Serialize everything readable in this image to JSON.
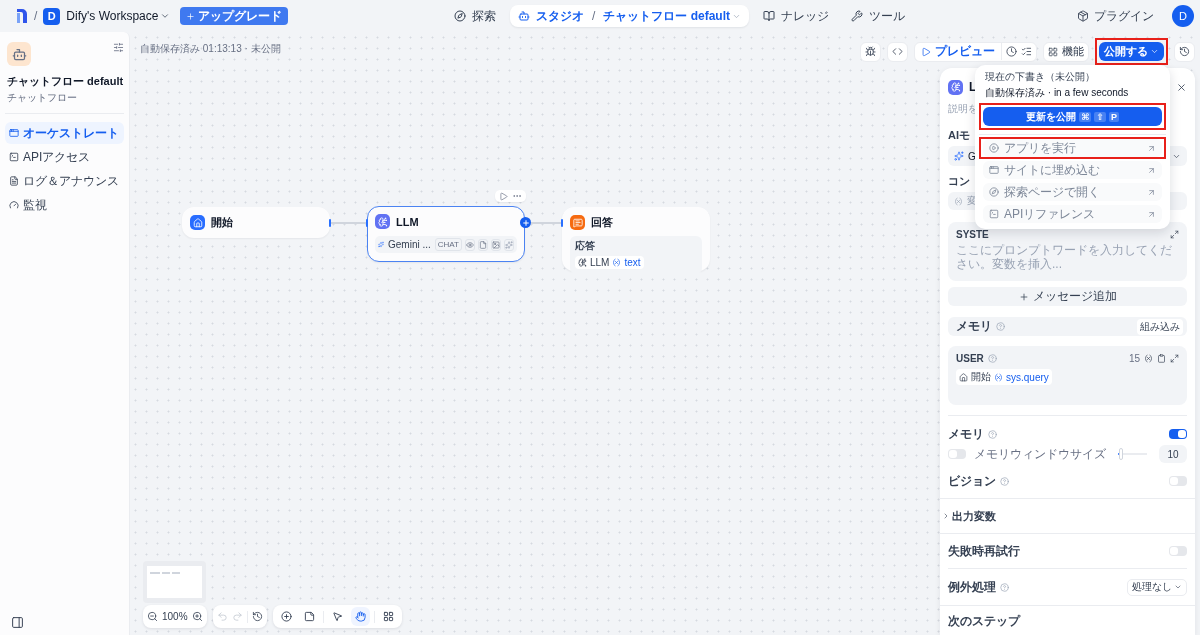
{
  "topbar": {
    "separator": "/",
    "workspace_initial": "D",
    "workspace": "Dify's Workspace",
    "upgrade": "アップグレード",
    "nav": [
      {
        "label": "探索",
        "selected": false
      },
      {
        "label": "スタジオ",
        "selected": true,
        "separator": "/",
        "app": "チャットフロー default"
      },
      {
        "label": "ナレッジ",
        "selected": false
      },
      {
        "label": "ツール",
        "selected": false
      }
    ],
    "plugins": "プラグイン",
    "avatar": "D"
  },
  "sidebar": {
    "app_title": "チャットフロー default",
    "app_type": "チャットフロー",
    "items": [
      {
        "label": "オーケストレート",
        "selected": true
      },
      {
        "label": "APIアクセス",
        "selected": false
      },
      {
        "label": "ログ＆アナウンス",
        "selected": false
      },
      {
        "label": "監視",
        "selected": false
      }
    ]
  },
  "canvas": {
    "status": "自動保存済み 01:13:13 · 未公開",
    "preview": "プレビュー",
    "features": "機能",
    "publish": {
      "label": "公開する",
      "highlighted": true
    },
    "nodes": [
      {
        "kind": "start",
        "title": "開始",
        "selected": false
      },
      {
        "kind": "llm",
        "title": "LLM",
        "selected": true,
        "model": "Gemini ...",
        "mode": "CHAT"
      },
      {
        "kind": "answer",
        "title": "回答",
        "selected": false,
        "field": "応答",
        "source": "LLM",
        "variable": "text"
      }
    ],
    "zoom": "100%",
    "tools": [
      {
        "kind": "add",
        "selected": false
      },
      {
        "kind": "note",
        "selected": false
      },
      {
        "kind": "pointer",
        "selected": false
      },
      {
        "kind": "hand",
        "selected": true
      },
      {
        "kind": "layout",
        "selected": false
      }
    ]
  },
  "publish_menu": {
    "title": "現在の下書き（未公開）",
    "status": "自動保存済み · in a few seconds",
    "button": {
      "label": "更新を公開",
      "keys": [
        "⌘",
        "⇧",
        "P"
      ],
      "highlighted": true
    },
    "items": [
      {
        "label": "アプリを実行",
        "disabled": true,
        "highlighted": true
      },
      {
        "label": "サイトに埋め込む",
        "disabled": true,
        "highlighted": false
      },
      {
        "label": "探索ページで開く",
        "disabled": true,
        "highlighted": false
      },
      {
        "label": "APIリファレンス",
        "disabled": true,
        "highlighted": false
      }
    ]
  },
  "panel": {
    "title": "L",
    "description": "説明を",
    "model_label": "AIモ",
    "model": "G",
    "context_label": "コン",
    "context": "変",
    "system": {
      "role": "SYSTE",
      "placeholder": "ここにプロンプトワードを入力してください。変数を挿入..."
    },
    "add_message": "メッセージ追加",
    "memory_row": {
      "label": "メモリ",
      "tag": "組み込み"
    },
    "user": {
      "role": "USER",
      "count": "15",
      "source": "開始",
      "variable": "sys.query"
    },
    "memory": {
      "label": "メモリ",
      "on": true
    },
    "memory_window": {
      "label": "メモリウィンドウサイズ",
      "on": false,
      "level": 0.1,
      "value": "10"
    },
    "vision": {
      "label": "ビジョン",
      "on": false
    },
    "output": {
      "label": "出力変数",
      "expanded": false
    },
    "retry": {
      "label": "失敗時再試行",
      "on": false
    },
    "error": {
      "label": "例外処理",
      "value": "処理なし"
    },
    "next": {
      "label": "次のステップ"
    }
  }
}
